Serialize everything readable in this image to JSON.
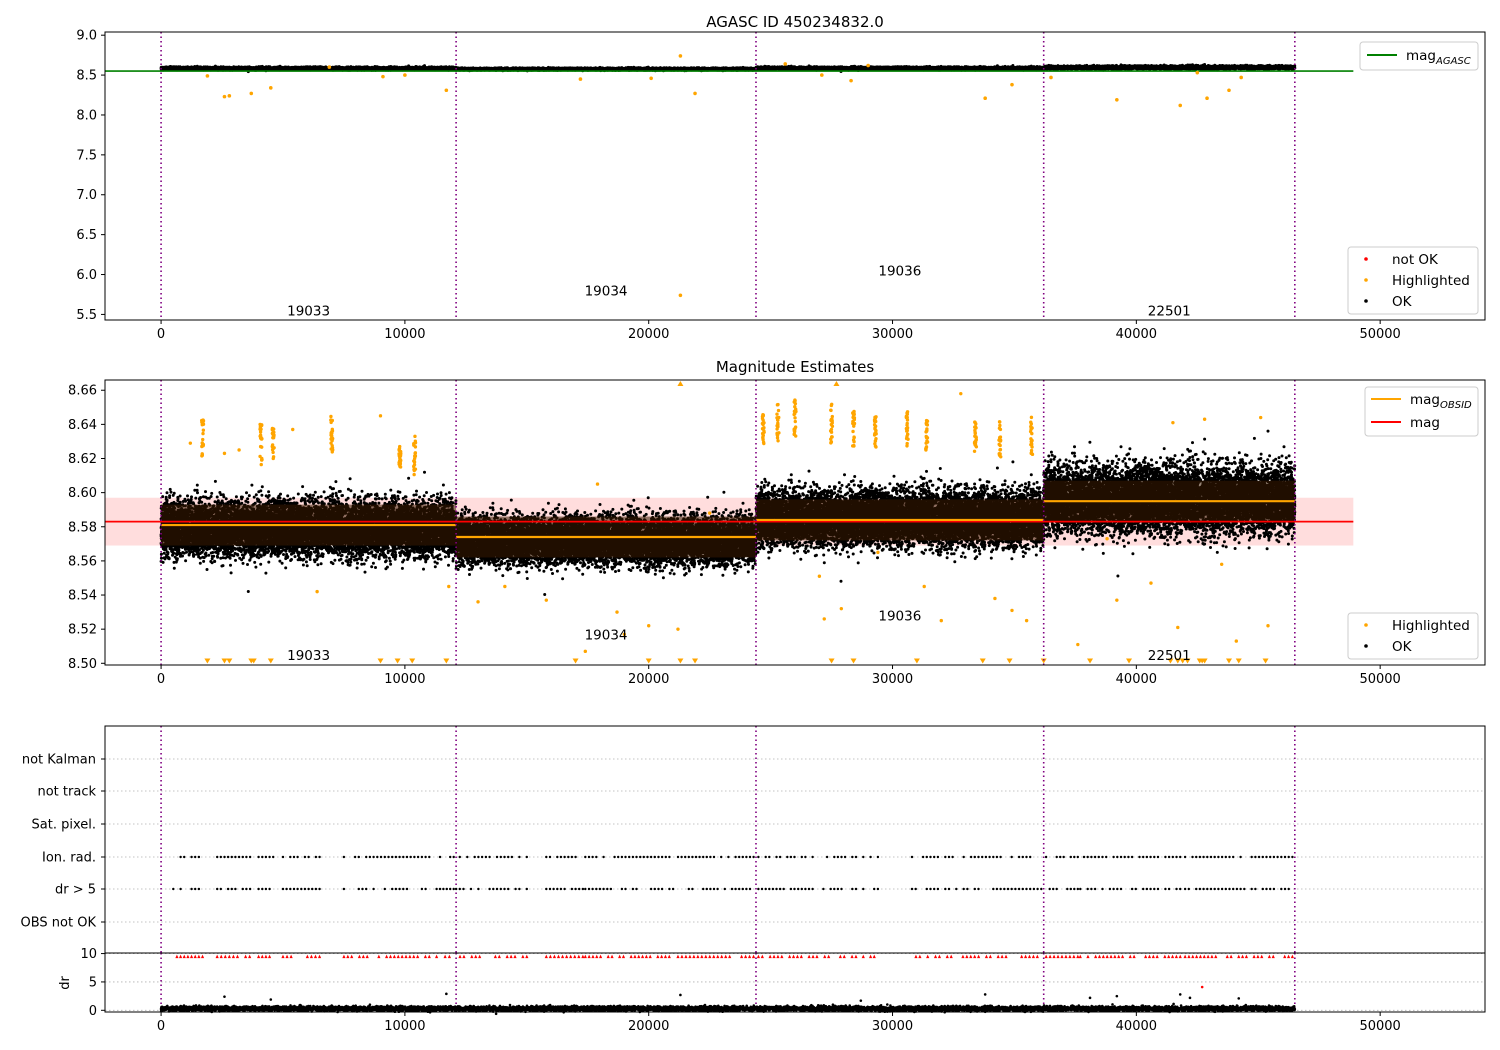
{
  "colors": {
    "ok": "#000000",
    "highlighted": "#ffa500",
    "not_ok": "#ff0000",
    "mag_agasc": "#008000",
    "mag_obsid": "#ffa500",
    "mag": "#ff0000",
    "mag_band": "#ffdddd",
    "obsid_separator": "#800080",
    "grid": "#b0b0b0"
  },
  "chart_data": [
    {
      "type": "scatter",
      "title": "AGASC ID 450234832.0",
      "xlim": [
        -2300,
        54300
      ],
      "ylim": [
        5.43,
        9.04
      ],
      "x_ticks": [
        0,
        10000,
        20000,
        30000,
        40000,
        50000
      ],
      "x_tick_labels": [
        "0",
        "10000",
        "20000",
        "30000",
        "40000",
        "50000"
      ],
      "y_ticks": [
        5.5,
        6.0,
        6.5,
        7.0,
        7.5,
        8.0,
        8.5,
        9.0
      ],
      "y_tick_labels": [
        "5.5",
        "6.0",
        "6.5",
        "7.0",
        "7.5",
        "8.0",
        "8.5",
        "9.0"
      ],
      "legends": [
        {
          "position": "upper-right",
          "entries": [
            {
              "kind": "line",
              "color": "#008000",
              "label_main": "mag",
              "label_sub": "AGASC"
            }
          ]
        },
        {
          "position": "lower-right",
          "entries": [
            {
              "kind": "dot",
              "color": "#ff0000",
              "label": "not OK"
            },
            {
              "kind": "dot",
              "color": "#ffa500",
              "label": "Highlighted"
            },
            {
              "kind": "dot",
              "color": "#000000",
              "label": "OK"
            }
          ]
        }
      ],
      "obsid_boundaries": [
        0,
        12100,
        24400,
        36200,
        46500
      ],
      "obsid_labels": [
        {
          "text": "19033",
          "x": 6050,
          "y": 5.55
        },
        {
          "text": "19034",
          "x": 18250,
          "y": 5.8
        },
        {
          "text": "19036",
          "x": 30300,
          "y": 6.05
        },
        {
          "text": "22501",
          "x": 41350,
          "y": 5.55
        }
      ],
      "mag_agasc": {
        "value": 8.55,
        "x_range": [
          -2300,
          48900
        ]
      },
      "ok_band": [
        {
          "x": [
            0,
            12100
          ],
          "center": 8.583,
          "spread": 0.015
        },
        {
          "x": [
            12100,
            24400
          ],
          "center": 8.575,
          "spread": 0.012
        },
        {
          "x": [
            24400,
            36200
          ],
          "center": 8.585,
          "spread": 0.015
        },
        {
          "x": [
            36200,
            46500
          ],
          "center": 8.595,
          "spread": 0.018
        }
      ],
      "highlighted_points": [
        {
          "x": 2600,
          "y": 8.23
        },
        {
          "x": 2800,
          "y": 8.24
        },
        {
          "x": 3700,
          "y": 8.27
        },
        {
          "x": 4500,
          "y": 8.34
        },
        {
          "x": 1900,
          "y": 8.49
        },
        {
          "x": 6900,
          "y": 8.6
        },
        {
          "x": 9100,
          "y": 8.48
        },
        {
          "x": 10000,
          "y": 8.5
        },
        {
          "x": 11700,
          "y": 8.31
        },
        {
          "x": 17200,
          "y": 8.45
        },
        {
          "x": 20100,
          "y": 8.46
        },
        {
          "x": 21300,
          "y": 8.74
        },
        {
          "x": 21900,
          "y": 8.27
        },
        {
          "x": 21300,
          "y": 5.74
        },
        {
          "x": 25600,
          "y": 8.64
        },
        {
          "x": 27100,
          "y": 8.5
        },
        {
          "x": 28300,
          "y": 8.43
        },
        {
          "x": 29000,
          "y": 8.62
        },
        {
          "x": 33800,
          "y": 8.21
        },
        {
          "x": 34900,
          "y": 8.38
        },
        {
          "x": 36500,
          "y": 8.47
        },
        {
          "x": 39200,
          "y": 8.19
        },
        {
          "x": 41800,
          "y": 8.12
        },
        {
          "x": 42500,
          "y": 8.53
        },
        {
          "x": 42900,
          "y": 8.21
        },
        {
          "x": 43800,
          "y": 8.31
        },
        {
          "x": 44300,
          "y": 8.47
        }
      ]
    },
    {
      "type": "scatter",
      "title": "Magnitude Estimates",
      "xlim": [
        -2300,
        54300
      ],
      "ylim": [
        8.499,
        8.666
      ],
      "x_ticks": [
        0,
        10000,
        20000,
        30000,
        40000,
        50000
      ],
      "x_tick_labels": [
        "0",
        "10000",
        "20000",
        "30000",
        "40000",
        "50000"
      ],
      "y_ticks": [
        8.5,
        8.52,
        8.54,
        8.56,
        8.58,
        8.6,
        8.62,
        8.64,
        8.66
      ],
      "y_tick_labels": [
        "8.50",
        "8.52",
        "8.54",
        "8.56",
        "8.58",
        "8.60",
        "8.62",
        "8.64",
        "8.66"
      ],
      "legends": [
        {
          "position": "upper-right",
          "entries": [
            {
              "kind": "line",
              "color": "#ffa500",
              "label_main": "mag",
              "label_sub": "OBSID"
            },
            {
              "kind": "line",
              "color": "#ff0000",
              "label_main": "mag",
              "label_sub": ""
            }
          ]
        },
        {
          "position": "lower-right",
          "entries": [
            {
              "kind": "dot",
              "color": "#ffa500",
              "label": "Highlighted"
            },
            {
              "kind": "dot",
              "color": "#000000",
              "label": "OK"
            }
          ]
        }
      ],
      "obsid_boundaries": [
        0,
        12100,
        24400,
        36200,
        46500
      ],
      "obsid_labels": [
        {
          "text": "19033",
          "x": 6050,
          "y": 8.505
        },
        {
          "text": "19034",
          "x": 18250,
          "y": 8.517
        },
        {
          "text": "19036",
          "x": 30300,
          "y": 8.528
        },
        {
          "text": "22501",
          "x": 41350,
          "y": 8.505
        }
      ],
      "mag": {
        "value": 8.583,
        "band": [
          8.569,
          8.597
        ],
        "x_range": [
          -2300,
          48900
        ]
      },
      "mag_obsid": [
        {
          "x": [
            0,
            12100
          ],
          "value": 8.581
        },
        {
          "x": [
            12100,
            24400
          ],
          "value": 8.574
        },
        {
          "x": [
            24400,
            36200
          ],
          "value": 8.584
        },
        {
          "x": [
            36200,
            46500
          ],
          "value": 8.595
        }
      ],
      "ok_band": [
        {
          "x": [
            0,
            12100
          ],
          "center": 8.579,
          "spread": 0.014
        },
        {
          "x": [
            12100,
            24400
          ],
          "center": 8.572,
          "spread": 0.012
        },
        {
          "x": [
            24400,
            36200
          ],
          "center": 8.585,
          "spread": 0.014
        },
        {
          "x": [
            36200,
            46500
          ],
          "center": 8.596,
          "spread": 0.017
        }
      ],
      "highlighted_clusters": [
        {
          "x": 1700,
          "y0": 8.621,
          "y1": 8.643
        },
        {
          "x": 4100,
          "y0": 8.616,
          "y1": 8.64
        },
        {
          "x": 4600,
          "y0": 8.618,
          "y1": 8.638
        },
        {
          "x": 7000,
          "y0": 8.621,
          "y1": 8.645
        },
        {
          "x": 9800,
          "y0": 8.615,
          "y1": 8.628
        },
        {
          "x": 10400,
          "y0": 8.61,
          "y1": 8.633
        },
        {
          "x": 24700,
          "y0": 8.628,
          "y1": 8.646
        },
        {
          "x": 25300,
          "y0": 8.63,
          "y1": 8.652
        },
        {
          "x": 26000,
          "y0": 8.632,
          "y1": 8.655
        },
        {
          "x": 27500,
          "y0": 8.629,
          "y1": 8.652
        },
        {
          "x": 28400,
          "y0": 8.627,
          "y1": 8.648
        },
        {
          "x": 29300,
          "y0": 8.626,
          "y1": 8.645
        },
        {
          "x": 30600,
          "y0": 8.627,
          "y1": 8.648
        },
        {
          "x": 31400,
          "y0": 8.624,
          "y1": 8.643
        },
        {
          "x": 33400,
          "y0": 8.623,
          "y1": 8.645
        },
        {
          "x": 34400,
          "y0": 8.62,
          "y1": 8.643
        },
        {
          "x": 35700,
          "y0": 8.622,
          "y1": 8.645
        }
      ],
      "highlighted_points": [
        {
          "x": 1200,
          "y": 8.629
        },
        {
          "x": 2600,
          "y": 8.623
        },
        {
          "x": 3200,
          "y": 8.625
        },
        {
          "x": 5400,
          "y": 8.637
        },
        {
          "x": 6400,
          "y": 8.542
        },
        {
          "x": 9000,
          "y": 8.645
        },
        {
          "x": 11800,
          "y": 8.545
        },
        {
          "x": 13000,
          "y": 8.536
        },
        {
          "x": 14100,
          "y": 8.545
        },
        {
          "x": 15800,
          "y": 8.537
        },
        {
          "x": 17400,
          "y": 8.507
        },
        {
          "x": 18700,
          "y": 8.53
        },
        {
          "x": 19000,
          "y": 8.517
        },
        {
          "x": 20000,
          "y": 8.522
        },
        {
          "x": 21200,
          "y": 8.52
        },
        {
          "x": 17900,
          "y": 8.605
        },
        {
          "x": 22500,
          "y": 8.588
        },
        {
          "x": 27000,
          "y": 8.551
        },
        {
          "x": 27200,
          "y": 8.526
        },
        {
          "x": 27900,
          "y": 8.532
        },
        {
          "x": 29400,
          "y": 8.565
        },
        {
          "x": 31300,
          "y": 8.545
        },
        {
          "x": 32000,
          "y": 8.525
        },
        {
          "x": 32800,
          "y": 8.658
        },
        {
          "x": 34200,
          "y": 8.538
        },
        {
          "x": 34900,
          "y": 8.531
        },
        {
          "x": 35500,
          "y": 8.525
        },
        {
          "x": 38800,
          "y": 8.573
        },
        {
          "x": 39200,
          "y": 8.537
        },
        {
          "x": 40600,
          "y": 8.547
        },
        {
          "x": 41500,
          "y": 8.641
        },
        {
          "x": 41700,
          "y": 8.521
        },
        {
          "x": 43500,
          "y": 8.558
        },
        {
          "x": 44100,
          "y": 8.513
        },
        {
          "x": 45100,
          "y": 8.644
        },
        {
          "x": 45400,
          "y": 8.522
        },
        {
          "x": 37600,
          "y": 8.511
        },
        {
          "x": 42800,
          "y": 8.643
        }
      ],
      "clipped_low_x": [
        1900,
        2600,
        2800,
        3700,
        3800,
        4500,
        9000,
        9700,
        10300,
        11700,
        17000,
        20000,
        21300,
        21900,
        27500,
        28400,
        31000,
        33700,
        34800,
        36200,
        38100,
        39700,
        41400,
        41700,
        41900,
        42100,
        42600,
        42700,
        42800,
        43800,
        44200,
        45300
      ],
      "clipped_high_x": [
        21300,
        27700
      ]
    },
    {
      "type": "scatter",
      "title": "",
      "xlim": [
        -2300,
        54300
      ],
      "y_labels": [
        "not Kalman",
        "not track",
        "Sat. pixel.",
        "Ion. rad.",
        "dr > 5",
        "OBS not OK"
      ],
      "obsid_boundaries": [
        0,
        12100,
        24400,
        36200,
        46500
      ],
      "flag_segments": [
        {
          "x": [
            500,
            1700
          ]
        },
        {
          "x": [
            2300,
            3800
          ]
        },
        {
          "x": [
            4000,
            4600
          ]
        },
        {
          "x": [
            5000,
            6500
          ]
        },
        {
          "x": [
            7500,
            11000
          ]
        },
        {
          "x": [
            11300,
            12000
          ]
        },
        {
          "x": [
            12100,
            15000
          ]
        },
        {
          "x": [
            15800,
            17300
          ]
        },
        {
          "x": [
            17400,
            21000
          ]
        },
        {
          "x": [
            21200,
            24300
          ]
        },
        {
          "x": [
            24500,
            28500
          ]
        },
        {
          "x": [
            28800,
            29400
          ]
        },
        {
          "x": [
            30800,
            36100
          ]
        },
        {
          "x": [
            36300,
            37600
          ]
        },
        {
          "x": [
            37700,
            41800
          ]
        },
        {
          "x": [
            42000,
            46400
          ]
        }
      ]
    },
    {
      "type": "scatter",
      "title": "",
      "xlim": [
        -2300,
        54300
      ],
      "ylim": [
        -0.3,
        10.1
      ],
      "ylabel": "dr",
      "x_ticks": [
        0,
        10000,
        20000,
        30000,
        40000,
        50000
      ],
      "x_tick_labels": [
        "0",
        "10000",
        "20000",
        "30000",
        "40000",
        "50000"
      ],
      "y_ticks": [
        0,
        5,
        10
      ],
      "y_tick_labels": [
        "0",
        "5",
        "10"
      ],
      "obsid_boundaries": [
        0,
        12100,
        24400,
        36200,
        46500
      ],
      "dr_band": {
        "x": [
          0,
          46500
        ],
        "center": 0.3,
        "spread": 0.35
      },
      "dr_outliers": [
        {
          "x": 2600,
          "y": 2.4
        },
        {
          "x": 4500,
          "y": 1.9
        },
        {
          "x": 11700,
          "y": 2.9
        },
        {
          "x": 21300,
          "y": 2.7
        },
        {
          "x": 28700,
          "y": 1.7
        },
        {
          "x": 33800,
          "y": 2.8
        },
        {
          "x": 38100,
          "y": 2.2
        },
        {
          "x": 39200,
          "y": 2.5
        },
        {
          "x": 41800,
          "y": 2.8
        },
        {
          "x": 42200,
          "y": 2.2
        },
        {
          "x": 42700,
          "y": 4.1
        },
        {
          "x": 44200,
          "y": 2.1
        }
      ]
    }
  ]
}
